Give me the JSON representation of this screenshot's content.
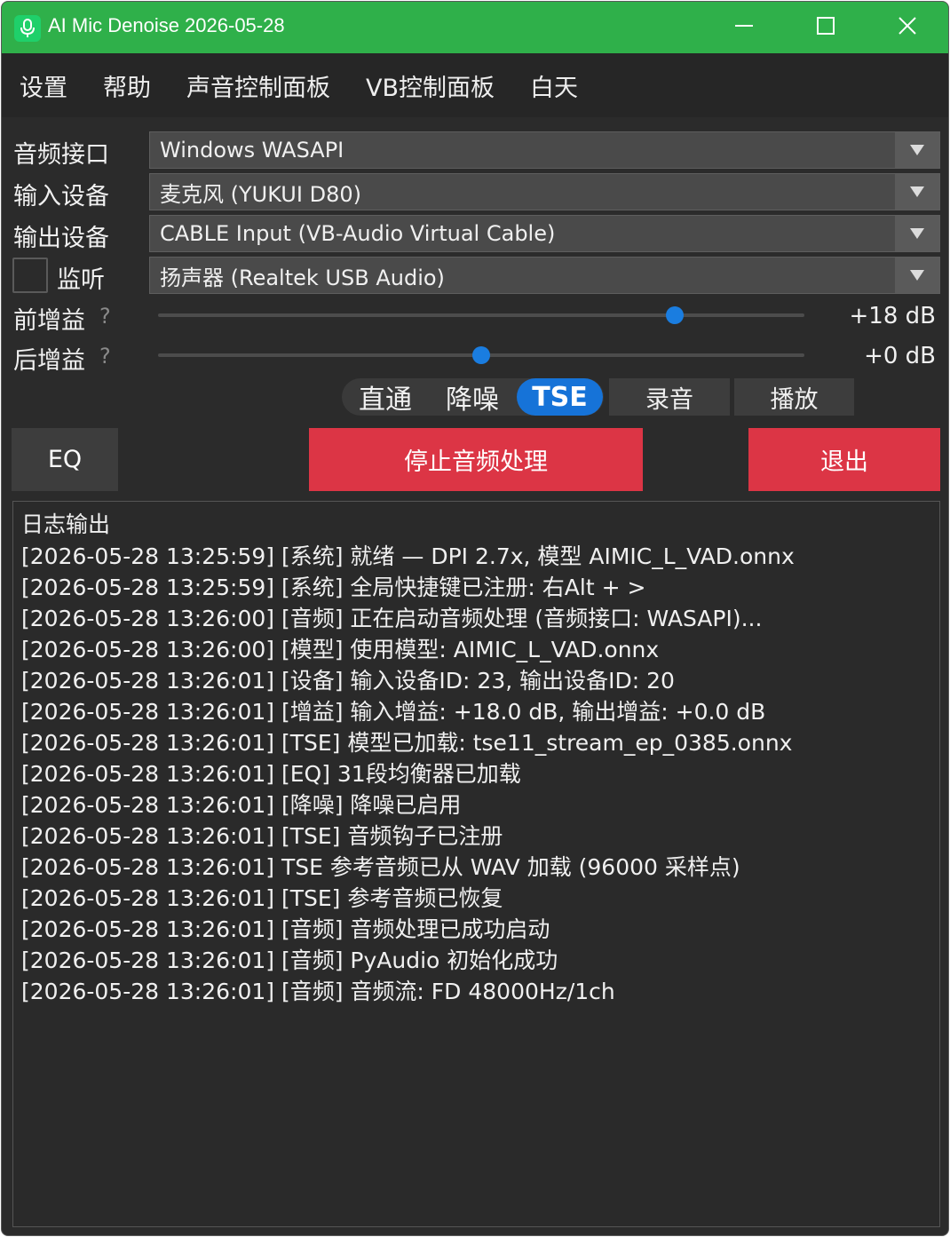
{
  "window": {
    "title": "AI Mic Denoise 2026-05-28",
    "title_bar_color": "#2fb04a",
    "icons": {
      "app": "microphone-icon",
      "minimize": "minimize-icon",
      "maximize": "maximize-icon",
      "close": "close-icon"
    }
  },
  "menu": {
    "items": [
      "设置",
      "帮助",
      "声音控制面板",
      "VB控制面板",
      "白天"
    ]
  },
  "form": {
    "audio_api": {
      "label": "音频接口",
      "value": "Windows WASAPI"
    },
    "input_device": {
      "label": "输入设备",
      "value": "麦克风 (YUKUI D80)"
    },
    "output_device": {
      "label": "输出设备",
      "value": "CABLE Input (VB-Audio Virtual Cable)"
    },
    "monitor": {
      "label": "监听",
      "checked": false,
      "value": "扬声器 (Realtek USB Audio)"
    },
    "pre_gain": {
      "label": "前增益",
      "help": "?",
      "value_text": "+18 dB",
      "value_db": 18
    },
    "post_gain": {
      "label": "后增益",
      "help": "?",
      "value_text": "+0 dB",
      "value_db": 0
    },
    "dropdown_icon": "triangle-down-icon"
  },
  "modes": {
    "options": [
      "直通",
      "降噪",
      "TSE"
    ],
    "selected": "TSE",
    "record": "录音",
    "play": "播放"
  },
  "actions": {
    "eq": "EQ",
    "stop": "停止音频处理",
    "exit": "退出",
    "accent_red": "#dc3545"
  },
  "log": {
    "title": "日志输出",
    "lines": [
      "[2026-05-28 13:25:59] [系统] 就绪 — DPI 2.7x, 模型 AIMIC_L_VAD.onnx",
      "[2026-05-28 13:25:59] [系统] 全局快捷键已注册: 右Alt + >",
      "[2026-05-28 13:26:00] [音频] 正在启动音频处理 (音频接口: WASAPI)...",
      "[2026-05-28 13:26:00] [模型] 使用模型: AIMIC_L_VAD.onnx",
      "[2026-05-28 13:26:01] [设备] 输入设备ID: 23, 输出设备ID: 20",
      "[2026-05-28 13:26:01] [增益] 输入增益: +18.0 dB, 输出增益: +0.0 dB",
      "[2026-05-28 13:26:01] [TSE] 模型已加载: tse11_stream_ep_0385.onnx",
      "[2026-05-28 13:26:01] [EQ] 31段均衡器已加载",
      "[2026-05-28 13:26:01] [降噪] 降噪已启用",
      "[2026-05-28 13:26:01] [TSE] 音频钩子已注册",
      "[2026-05-28 13:26:01] TSE 参考音频已从 WAV 加载 (96000 采样点)",
      "[2026-05-28 13:26:01] [TSE] 参考音频已恢复",
      "[2026-05-28 13:26:01] [音频] 音频处理已成功启动",
      "[2026-05-28 13:26:01] [音频] PyAudio 初始化成功",
      "[2026-05-28 13:26:01] [音频] 音频流: FD 48000Hz/1ch"
    ]
  }
}
